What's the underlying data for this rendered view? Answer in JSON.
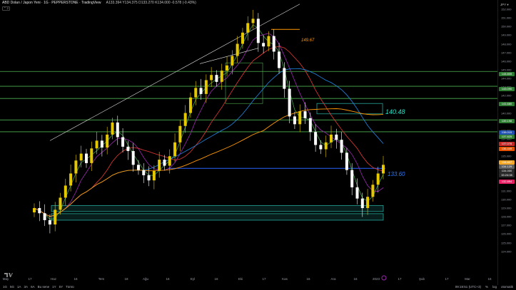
{
  "header": {
    "symbol": "ABD Doları / Japon Yeni · 1G · PEPPERSTONE · TradingView",
    "ohlc": "A133.394 Y134.375 D133.270 K134.000 -0.578 (-0.43%)",
    "collapse": "⌃ 2"
  },
  "price_axis": {
    "currency": "JPY ▾",
    "ticks": [
      "152.000",
      "151.000",
      "150.000",
      "149.000",
      "148.000",
      "147.000",
      "146.000",
      "145.000",
      "144.000",
      "143.000",
      "142.000",
      "141.000",
      "140.000",
      "139.000",
      "138.000",
      "137.000",
      "136.000",
      "135.000",
      "134.000",
      "133.000",
      "132.000",
      "131.000",
      "130.000",
      "129.000",
      "128.000",
      "127.000",
      "126.000",
      "125.000",
      "124.000"
    ],
    "tags": [
      {
        "label": "144.805",
        "color": "#2e7d32"
      },
      {
        "label": "143.090",
        "color": "#2e7d32"
      },
      {
        "label": "141.680",
        "color": "#2e7d32"
      },
      {
        "label": "139.198",
        "color": "#2e7d32"
      },
      {
        "label": "138.015",
        "color": "#1e4fb0"
      },
      {
        "label": "137.825",
        "color": "#2e7d32"
      },
      {
        "label": "137.078",
        "color": "#c62828"
      },
      {
        "label": "136.449",
        "color": "#e65100"
      },
      {
        "label": "134.807",
        "color": "#f5a623"
      },
      {
        "label": "134.129",
        "color": "#5d5d5d"
      },
      {
        "label": "134.000",
        "color": "#2a2a2a"
      },
      {
        "label": "15:24:08",
        "color": "#2a2a2a"
      },
      {
        "label": "132.894",
        "color": "#e91e63"
      }
    ]
  },
  "time_axis": {
    "labels": [
      "May",
      "17",
      "Haz",
      "16",
      "Tem",
      "18",
      "Ağu",
      "16",
      "Eyl",
      "16",
      "Eki",
      "17",
      "Kas",
      "16",
      "Ara",
      "16",
      "2023",
      "17",
      "Şub",
      "17",
      "Mar",
      "16"
    ]
  },
  "annotations": {
    "level_1": "149.67",
    "level_2": "140.48",
    "level_3": "133.60"
  },
  "bottom_bar": {
    "timeframes": [
      "1G",
      "5G",
      "1A",
      "3A",
      "6A",
      "Bu sene",
      "1Y",
      "5Y",
      "Tümü"
    ],
    "clock": "09:19:51 (UTC+3)",
    "percent": "%",
    "log": "log",
    "auto": "otomatik"
  },
  "colors": {
    "up": "#e6c800",
    "down": "#ffffff",
    "green_levels": "#4caf50",
    "blue_level": "#2962ff",
    "teal_box": "#26a69a",
    "orange_ma": "#ff9800",
    "red_ma": "#e53935",
    "purple_ma": "#9c27b0",
    "blue_ma": "#1e88e5",
    "green_ma": "#43a047"
  },
  "chart_data": {
    "type": "candlestick",
    "symbol": "USDJPY",
    "timeframe": "1D",
    "ylim": [
      123.5,
      152.5
    ],
    "trend_closes": [
      129.0,
      128.4,
      127.6,
      127.1,
      128.8,
      130.2,
      131.6,
      133.0,
      134.5,
      135.3,
      134.2,
      135.9,
      136.8,
      136.0,
      137.5,
      138.9,
      137.2,
      136.1,
      135.6,
      134.0,
      133.4,
      132.8,
      132.2,
      133.3,
      134.6,
      133.9,
      135.0,
      136.6,
      138.5,
      140.0,
      141.8,
      142.9,
      142.2,
      143.8,
      144.4,
      143.6,
      144.9,
      145.5,
      146.6,
      148.0,
      149.3,
      150.4,
      150.9,
      148.1,
      147.7,
      148.9,
      147.1,
      145.2,
      142.8,
      139.6,
      138.7,
      140.2,
      139.4,
      137.8,
      136.3,
      135.8,
      136.6,
      137.5,
      136.9,
      135.4,
      133.4,
      131.4,
      130.1,
      129.0,
      130.3,
      131.7,
      133.0,
      134.0
    ],
    "levels": {
      "resistance": 149.67,
      "box": 140.48,
      "support": 133.6
    }
  }
}
